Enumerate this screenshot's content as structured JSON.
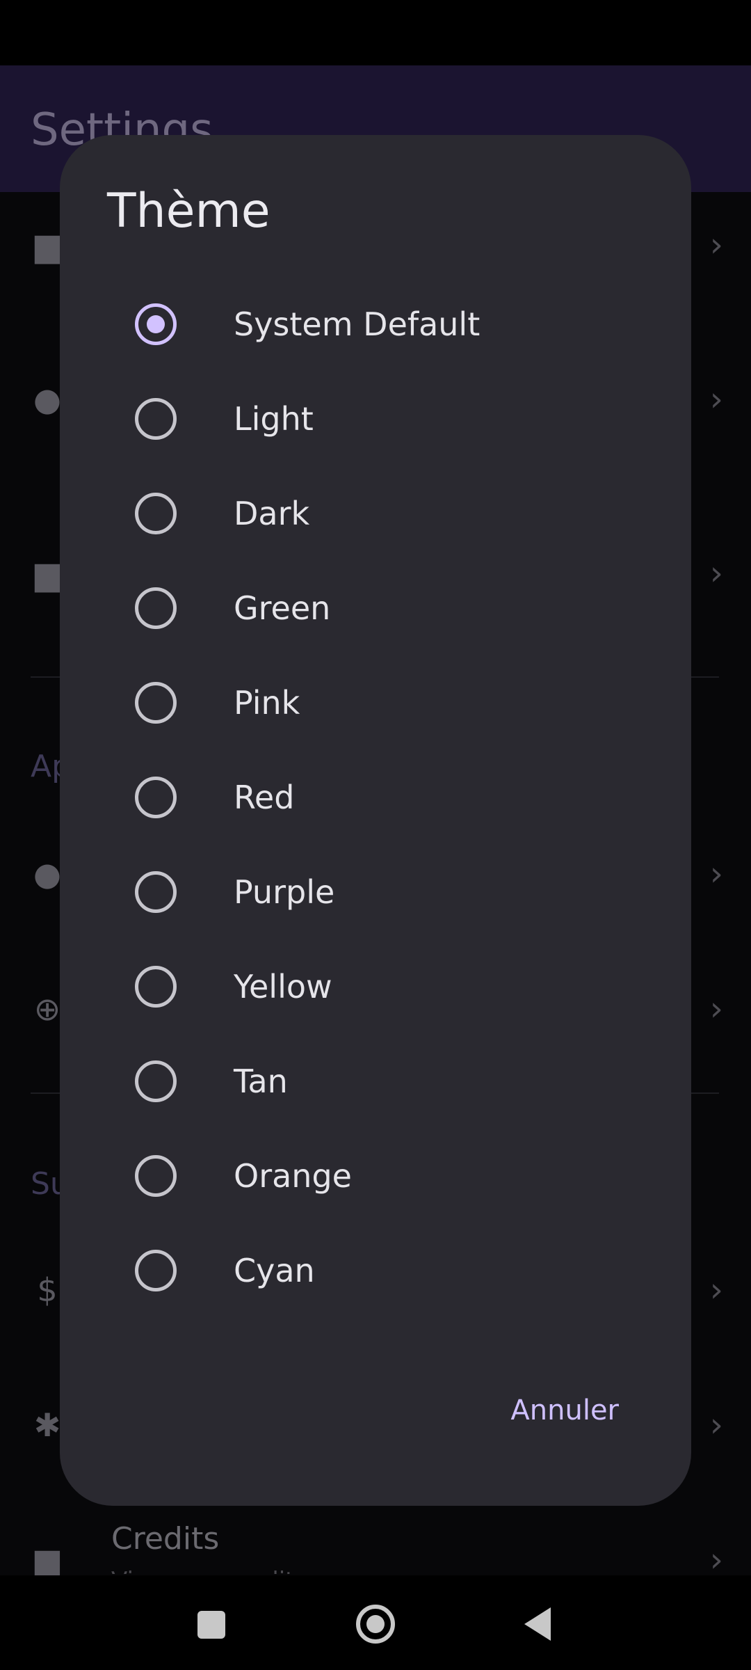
{
  "background": {
    "app_title": "Settings",
    "section_appearance": "Ap",
    "section_support": "Su",
    "credits_title": "Credits",
    "credits_subtitle": "View app credits"
  },
  "dialog": {
    "title": "Thème",
    "selected": "System Default",
    "options": [
      {
        "label": "System Default",
        "checked": true
      },
      {
        "label": "Light",
        "checked": false
      },
      {
        "label": "Dark",
        "checked": false
      },
      {
        "label": "Green",
        "checked": false
      },
      {
        "label": "Pink",
        "checked": false
      },
      {
        "label": "Red",
        "checked": false
      },
      {
        "label": "Purple",
        "checked": false
      },
      {
        "label": "Yellow",
        "checked": false
      },
      {
        "label": "Tan",
        "checked": false
      },
      {
        "label": "Orange",
        "checked": false
      },
      {
        "label": "Cyan",
        "checked": false
      }
    ],
    "cancel_label": "Annuler"
  },
  "colors": {
    "dialog_bg": "#2a2930",
    "accent": "#d2c2ff",
    "app_bar": "#1b1430"
  },
  "icons": {
    "nav_recents": "square-icon",
    "nav_home": "home-circle-icon",
    "nav_back": "back-triangle-icon"
  }
}
